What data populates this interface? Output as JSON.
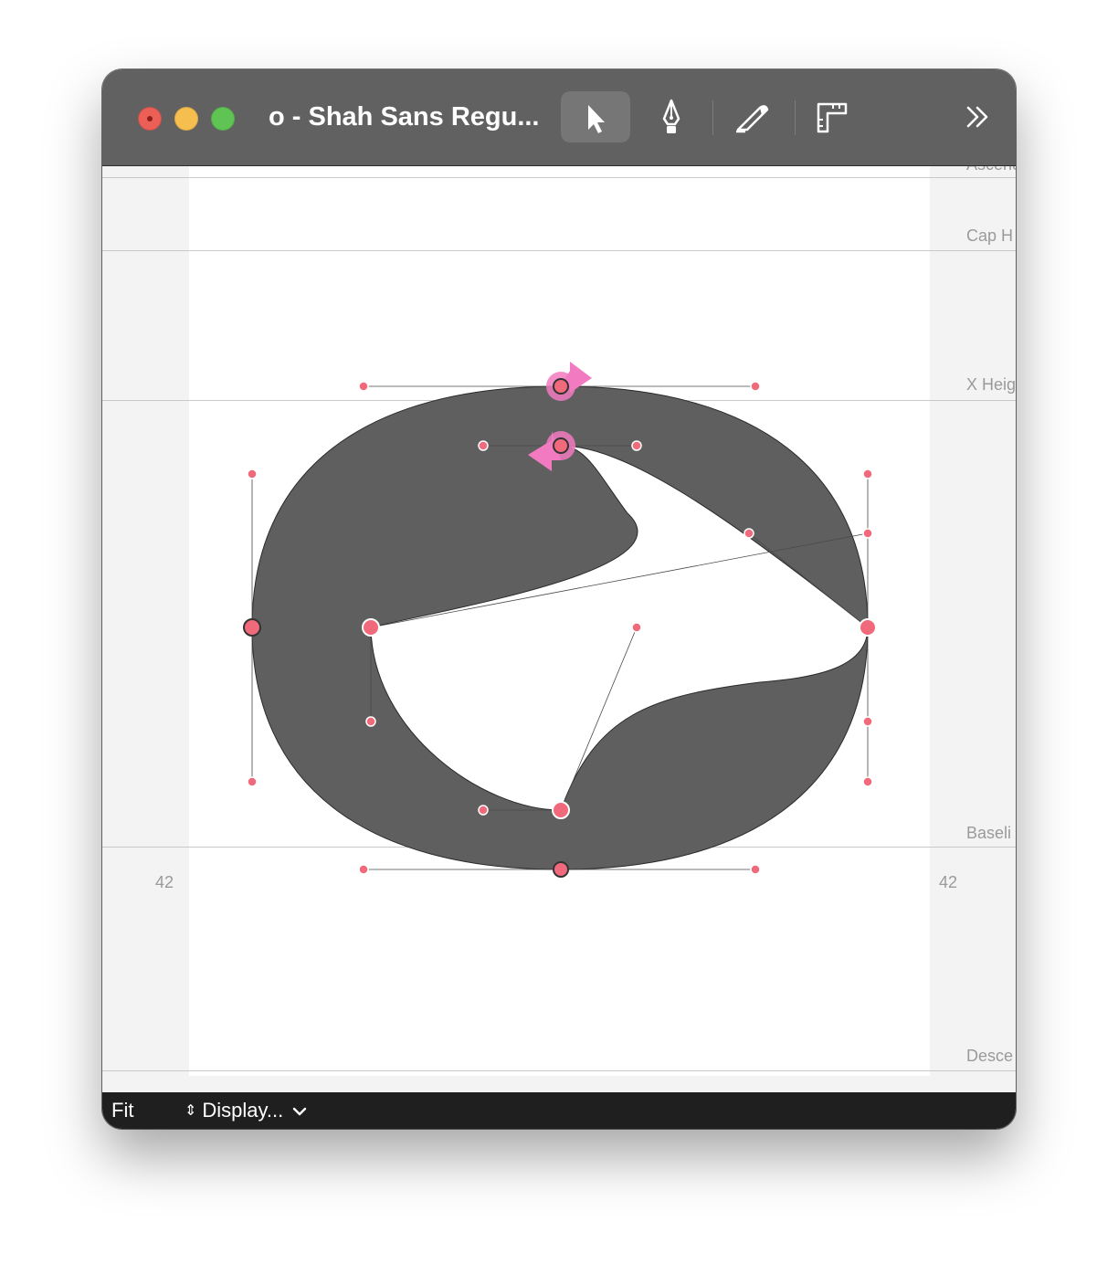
{
  "window": {
    "title": "o - Shah Sans Regu...",
    "traffic_lights": {
      "close": "#ec5f57",
      "minimize": "#f5be4f",
      "maximize": "#5fc454"
    }
  },
  "toolbar": {
    "tools": [
      {
        "name": "select",
        "icon": "pointer-arrow-icon",
        "active": true
      },
      {
        "name": "pen",
        "icon": "pen-nib-icon",
        "active": false
      },
      {
        "name": "knife",
        "icon": "knife-icon",
        "active": false
      },
      {
        "name": "metrics",
        "icon": "ruler-square-icon",
        "active": false
      }
    ],
    "overflow_icon": "double-chevron-right-icon"
  },
  "metrics": {
    "ascender": "Ascender",
    "cap_height": "Cap H",
    "x_height": "X Heig",
    "baseline": "Baseli",
    "descender": "Desce"
  },
  "sidebearings": {
    "left": "42",
    "right": "42"
  },
  "colors": {
    "glyph_fill": "#5f5f5f",
    "point": "#f06a7b",
    "handle": "#f06a7b",
    "start_arrow": "#f27ac0",
    "titlebar": "#616161",
    "statusbar": "#1f1f1f"
  },
  "statusbar": {
    "zoom": "Fit",
    "display": "Display..."
  }
}
